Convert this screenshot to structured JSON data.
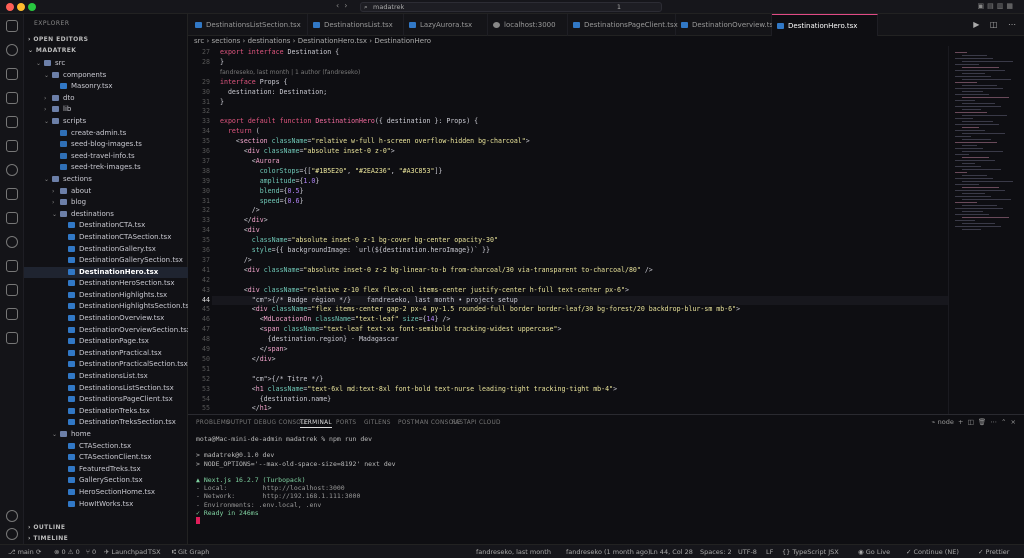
{
  "window": {
    "search_text": "madatrek",
    "search_count": "1"
  },
  "sidebar": {
    "title": "EXPLORER",
    "open_editors": "OPEN EDITORS",
    "root": "MADATREK",
    "outline": "OUTLINE",
    "timeline": "TIMELINE",
    "tree": [
      {
        "label": "src",
        "level": 1,
        "kind": "folder",
        "open": true
      },
      {
        "label": "components",
        "level": 2,
        "kind": "folder",
        "open": true
      },
      {
        "label": "Masonry.tsx",
        "level": 3,
        "kind": "tsx"
      },
      {
        "label": "dto",
        "level": 2,
        "kind": "folder"
      },
      {
        "label": "lib",
        "level": 2,
        "kind": "folder"
      },
      {
        "label": "scripts",
        "level": 2,
        "kind": "folder",
        "open": true
      },
      {
        "label": "create-admin.ts",
        "level": 3,
        "kind": "ts"
      },
      {
        "label": "seed-blog-images.ts",
        "level": 3,
        "kind": "ts"
      },
      {
        "label": "seed-travel-info.ts",
        "level": 3,
        "kind": "ts"
      },
      {
        "label": "seed-trek-images.ts",
        "level": 3,
        "kind": "ts"
      },
      {
        "label": "sections",
        "level": 2,
        "kind": "folder",
        "open": true
      },
      {
        "label": "about",
        "level": 3,
        "kind": "folder"
      },
      {
        "label": "blog",
        "level": 3,
        "kind": "folder"
      },
      {
        "label": "destinations",
        "level": 3,
        "kind": "folder",
        "open": true
      },
      {
        "label": "DestinationCTA.tsx",
        "level": 4,
        "kind": "tsx"
      },
      {
        "label": "DestinationCTASection.tsx",
        "level": 4,
        "kind": "tsx"
      },
      {
        "label": "DestinationGallery.tsx",
        "level": 4,
        "kind": "tsx"
      },
      {
        "label": "DestinationGallerySection.tsx",
        "level": 4,
        "kind": "tsx"
      },
      {
        "label": "DestinationHero.tsx",
        "level": 4,
        "kind": "tsx",
        "active": true
      },
      {
        "label": "DestinationHeroSection.tsx",
        "level": 4,
        "kind": "tsx"
      },
      {
        "label": "DestinationHighlights.tsx",
        "level": 4,
        "kind": "tsx"
      },
      {
        "label": "DestinationHighlightsSection.tsx",
        "level": 4,
        "kind": "tsx"
      },
      {
        "label": "DestinationOverview.tsx",
        "level": 4,
        "kind": "tsx"
      },
      {
        "label": "DestinationOverviewSection.tsx",
        "level": 4,
        "kind": "tsx"
      },
      {
        "label": "DestinationPage.tsx",
        "level": 4,
        "kind": "tsx"
      },
      {
        "label": "DestinationPractical.tsx",
        "level": 4,
        "kind": "tsx"
      },
      {
        "label": "DestinationPracticalSection.tsx",
        "level": 4,
        "kind": "tsx"
      },
      {
        "label": "DestinationsList.tsx",
        "level": 4,
        "kind": "tsx"
      },
      {
        "label": "DestinationsListSection.tsx",
        "level": 4,
        "kind": "tsx"
      },
      {
        "label": "DestinationsPageClient.tsx",
        "level": 4,
        "kind": "tsx"
      },
      {
        "label": "DestinationTreks.tsx",
        "level": 4,
        "kind": "tsx"
      },
      {
        "label": "DestinationTreksSection.tsx",
        "level": 4,
        "kind": "tsx"
      },
      {
        "label": "home",
        "level": 3,
        "kind": "folder",
        "open": true
      },
      {
        "label": "CTASection.tsx",
        "level": 4,
        "kind": "tsx"
      },
      {
        "label": "CTASectionClient.tsx",
        "level": 4,
        "kind": "tsx"
      },
      {
        "label": "FeaturedTreks.tsx",
        "level": 4,
        "kind": "tsx"
      },
      {
        "label": "GallerySection.tsx",
        "level": 4,
        "kind": "tsx"
      },
      {
        "label": "HeroSectionHome.tsx",
        "level": 4,
        "kind": "tsx"
      },
      {
        "label": "HowItWorks.tsx",
        "level": 4,
        "kind": "tsx"
      }
    ]
  },
  "tabs": [
    {
      "label": "DestinationsListSection.tsx"
    },
    {
      "label": "DestinationsList.tsx"
    },
    {
      "label": "LazyAurora.tsx"
    },
    {
      "label": "localhost:3000"
    },
    {
      "label": "DestinationsPageClient.tsx"
    },
    {
      "label": "DestinationOverview.tsx"
    },
    {
      "label": "DestinationHero.tsx",
      "active": true
    }
  ],
  "breadcrumb": "src › sections › destinations › DestinationHero.tsx › DestinationHero",
  "editor": {
    "codelens": "fandreseko, last month | 1 author (fandreseko)",
    "lines": [
      {
        "n": "27",
        "t": "export interface Destination {"
      },
      {
        "n": "28",
        "t": "}"
      },
      {
        "n": "",
        "t": ""
      },
      {
        "n": "29",
        "t": "interface Props {"
      },
      {
        "n": "30",
        "t": "  destination: Destination;"
      },
      {
        "n": "31",
        "t": "}"
      },
      {
        "n": "32",
        "t": ""
      },
      {
        "n": "33",
        "t": "export default function DestinationHero({ destination }: Props) {"
      },
      {
        "n": "34",
        "t": "  return ("
      },
      {
        "n": "35",
        "t": "    <section className=\"relative w-full h-screen overflow-hidden bg-charcoal\">"
      },
      {
        "n": "36",
        "t": "      <div className=\"absolute inset-0 z-0\">"
      },
      {
        "n": "37",
        "t": "        <Aurora"
      },
      {
        "n": "38",
        "t": "          colorStops={[\"#1B5E20\", \"#2EA236\", \"#A3C853\"]}"
      },
      {
        "n": "39",
        "t": "          amplitude={1.0}"
      },
      {
        "n": "30",
        "t": "          blend={0.5}"
      },
      {
        "n": "31",
        "t": "          speed={0.6}"
      },
      {
        "n": "32",
        "t": "        />"
      },
      {
        "n": "33",
        "t": "      </div>"
      },
      {
        "n": "34",
        "t": "      <div"
      },
      {
        "n": "35",
        "t": "        className=\"absolute inset-0 z-1 bg-cover bg-center opacity-30\""
      },
      {
        "n": "36",
        "t": "        style={{ backgroundImage: `url(${destination.heroImage})` }}"
      },
      {
        "n": "37",
        "t": "      />"
      },
      {
        "n": "41",
        "t": "      <div className=\"absolute inset-0 z-2 bg-linear-to-b from-charcoal/30 via-transparent to-charcoal/80\" />"
      },
      {
        "n": "42",
        "t": ""
      },
      {
        "n": "43",
        "t": "      <div className=\"relative z-10 flex flex-col items-center justify-center h-full text-center px-6\">"
      },
      {
        "n": "44",
        "t": "        {/* Badge région */}    fandreseko, last month • project setup",
        "cur": true
      },
      {
        "n": "45",
        "t": "        <div className=\"flex items-center gap-2 px-4 py-1.5 rounded-full border border-leaf/30 bg-forest/20 backdrop-blur-sm mb-6\">"
      },
      {
        "n": "46",
        "t": "          <MdLocationOn className=\"text-leaf\" size={14} />"
      },
      {
        "n": "47",
        "t": "          <span className=\"text-leaf text-xs font-semibold tracking-widest uppercase\">"
      },
      {
        "n": "48",
        "t": "            {destination.region} · Madagascar"
      },
      {
        "n": "49",
        "t": "          </span>"
      },
      {
        "n": "50",
        "t": "        </div>"
      },
      {
        "n": "51",
        "t": ""
      },
      {
        "n": "52",
        "t": "        {/* Titre */}"
      },
      {
        "n": "53",
        "t": "        <h1 className=\"text-6xl md:text-8xl font-bold text-nurse leading-tight tracking-tight mb-4\">"
      },
      {
        "n": "54",
        "t": "          {destination.name}"
      },
      {
        "n": "55",
        "t": "        </h1>"
      },
      {
        "n": "56",
        "t": ""
      }
    ]
  },
  "panel": {
    "tabs": [
      "PROBLEMS",
      "OUTPUT",
      "DEBUG CONSOLE",
      "TERMINAL",
      "PORTS",
      "GITLENS",
      "POSTMAN CONSOLE",
      "FASTAPI CLOUD"
    ],
    "active_tab": "TERMINAL",
    "shell": "node",
    "terminal": [
      "mota@Mac-mini-de-admin madatrek % npm run dev",
      "",
      "> madatrek@0.1.0 dev",
      "> NODE_OPTIONS='--max-old-space-size=8192' next dev",
      "",
      "▲ Next.js 16.2.7 (Turbopack)",
      "- Local:         http://localhost:3000",
      "- Network:       http://192.168.1.111:3000",
      "- Environments: .env.local, .env",
      "✓ Ready in 246ms"
    ]
  },
  "status": {
    "branch": "main",
    "sync": "⟳",
    "errors": "0",
    "warnings": "0",
    "ports": "0",
    "launchpad": "Launchpad",
    "tsx": "TSX",
    "gitgraph": "Git Graph",
    "blame": "fandreseko, last month",
    "author": "fandreseko (1 month ago)",
    "position": "Ln 44, Col 28",
    "spaces": "Spaces: 2",
    "encoding": "UTF-8",
    "eol": "LF",
    "language": "TypeScript JSX",
    "golive": "Go Live",
    "continue": "Continue (NE)",
    "prettier": "Prettier"
  }
}
